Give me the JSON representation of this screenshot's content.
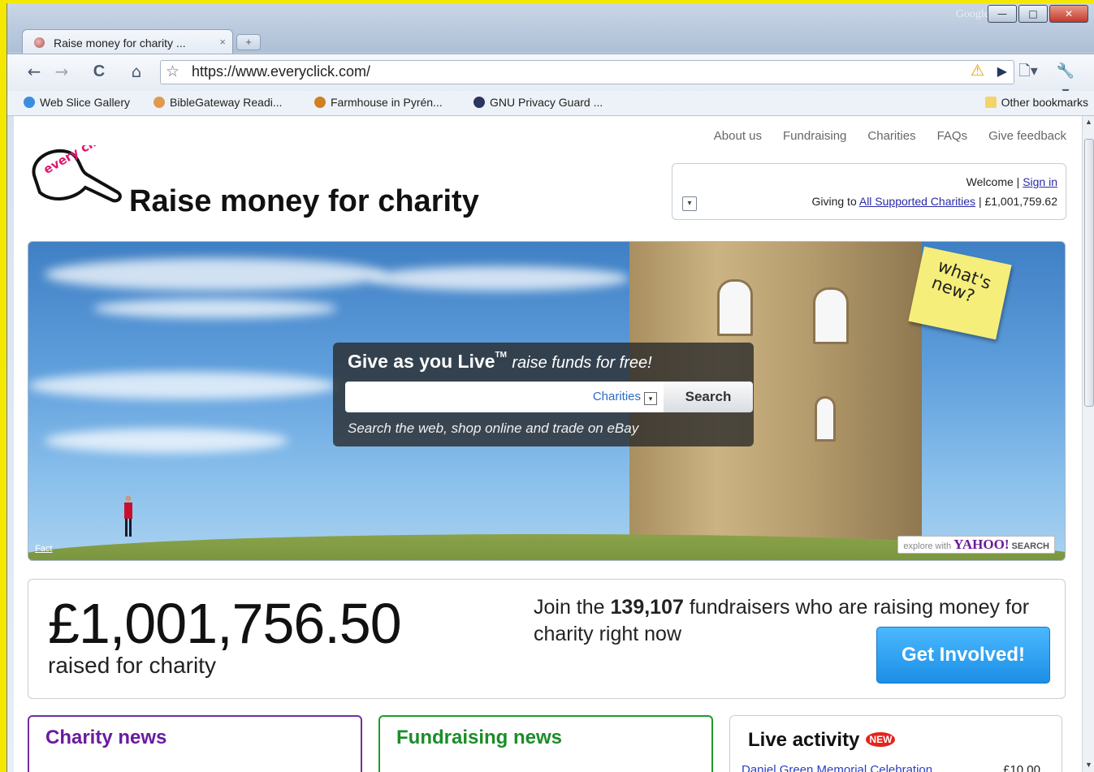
{
  "browser": {
    "title_search_label": "Google",
    "window_buttons": {
      "minimize": "—",
      "maximize": "□",
      "close": "✕"
    },
    "tab": {
      "title": "Raise money for charity ...",
      "close": "×"
    },
    "new_tab": "+",
    "nav": {
      "back": "←",
      "forward": "→",
      "reload": "C",
      "home": "⌂"
    },
    "address": "https://www.everyclick.com/",
    "bookmarks": [
      {
        "label": "Web Slice Gallery"
      },
      {
        "label": "BibleGateway Readi..."
      },
      {
        "label": "Farmhouse in Pyrén..."
      },
      {
        "label": "GNU Privacy Guard ..."
      }
    ],
    "other_bookmarks": "Other bookmarks"
  },
  "site": {
    "topnav": [
      "About us",
      "Fundraising",
      "Charities",
      "FAQs",
      "Give feedback"
    ],
    "logo_text": "every click",
    "title": "Raise money for charity",
    "account": {
      "welcome": "Welcome |",
      "sign_in": "Sign in",
      "giving_to": "Giving to",
      "charities_link": "All Supported Charities",
      "total": "| £1,001,759.62"
    },
    "hero": {
      "note": "what's new?",
      "title": "Give as you Live",
      "tm": "TM",
      "tagline": "raise funds for free!",
      "search_placeholder": "",
      "category": "Charities",
      "button": "Search",
      "subtext": "Search the web, shop online and trade on eBay",
      "fact": "Fact",
      "yahoo_prefix": "explore with",
      "yahoo_brand": "YAHOO!",
      "yahoo_suffix": "SEARCH"
    },
    "stats": {
      "amount": "£1,001,756.50",
      "amount_label": "raised for charity",
      "join_prefix": "Join the",
      "fundraisers": "139,107",
      "join_suffix": "fundraisers who are raising money for charity right now",
      "cta": "Get Involved!"
    },
    "panels": {
      "charity_news": "Charity news",
      "fundraising_news": "Fundraising news",
      "live_activity": "Live activity",
      "new_badge": "NEW",
      "activity_item": "Daniel Green Memorial Celebration",
      "activity_amount": "£10.00"
    }
  }
}
